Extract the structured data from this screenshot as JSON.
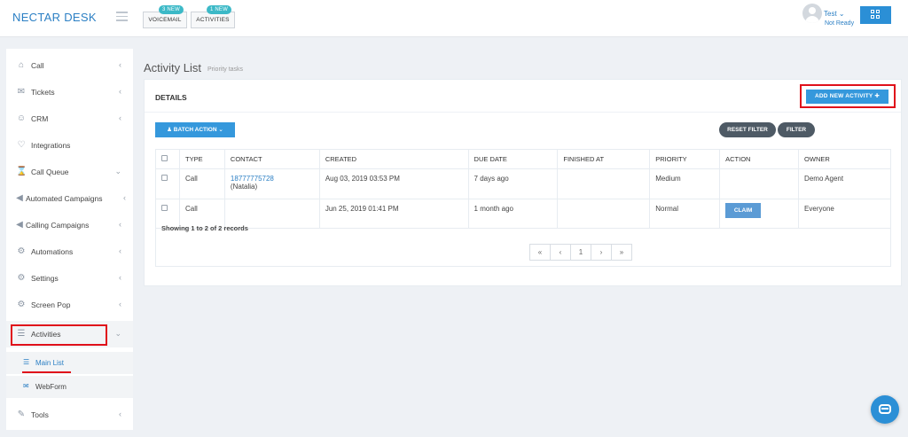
{
  "app": {
    "brand": "NECTAR DESK"
  },
  "topbar": {
    "voicemail": {
      "label": "VOICEMAIL",
      "badge": "3 NEW"
    },
    "activities": {
      "label": "ACTIVITIES",
      "badge": "1 NEW"
    },
    "user": {
      "name": "Test ⌄",
      "status": "Not Ready"
    }
  },
  "sidebar": {
    "items": [
      {
        "label": "Call",
        "icon": "home-icon",
        "chevron": "‹"
      },
      {
        "label": "Tickets",
        "icon": "envelope-icon",
        "chevron": "‹"
      },
      {
        "label": "CRM",
        "icon": "user-icon",
        "chevron": "‹"
      },
      {
        "label": "Integrations",
        "icon": "handshake-icon",
        "chevron": ""
      },
      {
        "label": "Call Queue",
        "icon": "hourglass-icon",
        "chevron": "⌄"
      },
      {
        "label": "Automated Campaigns",
        "icon": "bullhorn-icon",
        "chevron": "‹"
      },
      {
        "label": "Calling Campaigns",
        "icon": "bullhorn-icon",
        "chevron": "‹"
      },
      {
        "label": "Automations",
        "icon": "gear-icon",
        "chevron": "‹"
      },
      {
        "label": "Settings",
        "icon": "gear-icon",
        "chevron": "‹"
      },
      {
        "label": "Screen Pop",
        "icon": "gear-icon",
        "chevron": "‹"
      },
      {
        "label": "Activities",
        "icon": "list-icon",
        "chevron": "⌄"
      },
      {
        "label": "Tools",
        "icon": "wrench-icon",
        "chevron": "‹"
      }
    ],
    "subitems": [
      {
        "label": "Main List",
        "icon": "list-icon"
      },
      {
        "label": "WebForm",
        "icon": "envelope-icon"
      }
    ]
  },
  "page": {
    "title": "Activity List",
    "subtitle": "Priority tasks"
  },
  "panel": {
    "title": "DETAILS",
    "add_button": "ADD NEW ACTIVITY ✚",
    "batch_button": "♟ BATCH ACTION ⌄",
    "reset_filter": "RESET FILTER",
    "filter": "FILTER"
  },
  "table": {
    "headers": [
      "TYPE",
      "CONTACT",
      "CREATED",
      "DUE DATE",
      "FINISHED AT",
      "PRIORITY",
      "ACTION",
      "OWNER"
    ],
    "rows": [
      {
        "type": "Call",
        "contact_number": "18777775728",
        "contact_name": "(Natalia)",
        "created": "Aug 03, 2019 03:53 PM",
        "due": "7 days ago",
        "finished": "",
        "priority": "Medium",
        "action": "",
        "owner": "Demo Agent"
      },
      {
        "type": "Call",
        "contact_number": "",
        "contact_name": "",
        "created": "Jun 25, 2019 01:41 PM",
        "due": "1 month ago",
        "finished": "",
        "priority": "Normal",
        "action": "CLAIM",
        "owner": "Everyone"
      }
    ],
    "records_text": "Showing 1 to 2 of 2 records"
  },
  "pagination": {
    "first": "«",
    "prev": "‹",
    "current": "1",
    "next": "›",
    "last": "»"
  },
  "colors": {
    "accent": "#3598dc",
    "brand": "#2b7fc4",
    "highlight": "#e0101a",
    "dark_pill": "#4e5a65"
  }
}
